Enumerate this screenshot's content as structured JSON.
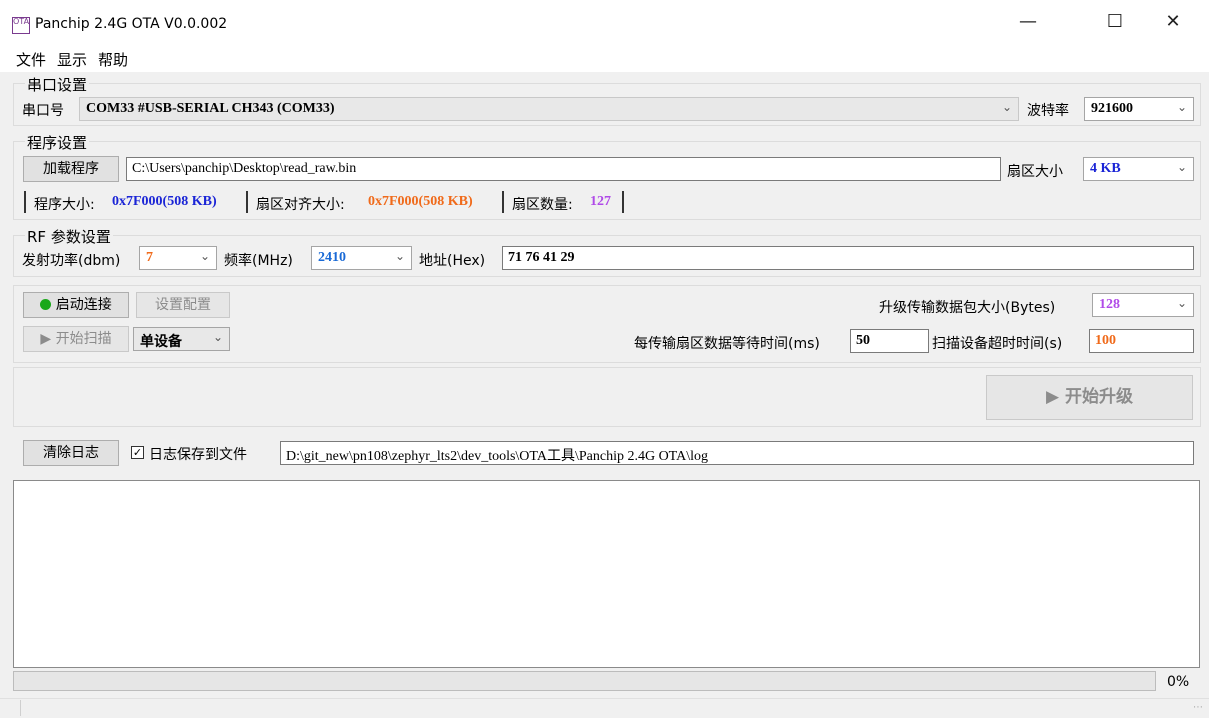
{
  "window": {
    "title": "Panchip 2.4G OTA V0.0.002",
    "icon": "app-logo-icon",
    "icon_text": "OTA"
  },
  "menu": {
    "items": [
      "文件",
      "显示",
      "帮助"
    ]
  },
  "serial": {
    "group": "串口设置",
    "port_label": "串口号",
    "port_value": "COM33 #USB-SERIAL CH343 (COM33)",
    "baud_label": "波特率",
    "baud_value": "921600"
  },
  "program": {
    "group": "程序设置",
    "load_button": "加载程序",
    "path": "C:\\Users\\panchip\\Desktop\\read_raw.bin",
    "sector_label": "扇区大小",
    "sector_value": "4 KB",
    "size_label": "程序大小: ",
    "size_value": "0x7F000(508 KB)",
    "aligned_label": "扇区对齐大小: ",
    "aligned_value": "0x7F000(508 KB)",
    "count_label": "扇区数量: ",
    "count_value": "127"
  },
  "rf": {
    "group": "RF 参数设置",
    "power_label": "发射功率(dbm)",
    "power_value": "7",
    "freq_label": "频率(MHz)",
    "freq_value": "2410",
    "addr_label": "地址(Hex)",
    "addr_value": "71 76 41 29"
  },
  "conn": {
    "start_connect": "启动连接",
    "set_config": "设置配置",
    "start_scan": "开始扫描",
    "mode_value": "单设备",
    "packet_label": "升级传输数据包大小(Bytes)",
    "packet_value": "128",
    "wait_label": "每传输扇区数据等待时间(ms)",
    "wait_value": "50",
    "timeout_label": "扫描设备超时时间(s)",
    "timeout_value": "100"
  },
  "upgrade": {
    "start_upgrade": "开始升级"
  },
  "log": {
    "clear_button": "清除日志",
    "save_label": "日志保存到文件",
    "save_checked": true,
    "path": "D:\\git_new\\pn108\\zephyr_lts2\\dev_tools\\OTA工具\\Panchip 2.4G OTA\\log",
    "content": ""
  },
  "progress": {
    "value": 0,
    "text": "0%"
  },
  "colors": {
    "blue": "#1a24d6",
    "orange": "#f06a1a",
    "purple": "#b04ae8",
    "green": "#1aa81a"
  }
}
